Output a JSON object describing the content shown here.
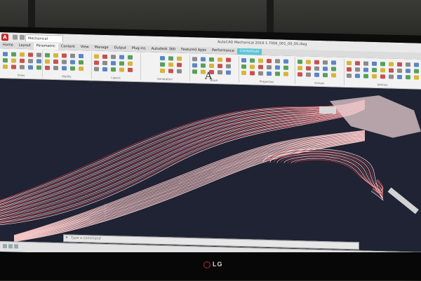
{
  "app": {
    "document_tab": "Mechanical",
    "window_title": "AutoCAD Mechanical 2016    1.7006_001_00_00.dwg",
    "command_placeholder": "Type a command",
    "command_close": "✕",
    "brand_logo": "LG"
  },
  "ribbon_tabs": [
    {
      "label": "Home",
      "active": false
    },
    {
      "label": "Layout",
      "active": false
    },
    {
      "label": "Parametric",
      "active": true
    },
    {
      "label": "Content",
      "active": false
    },
    {
      "label": "View",
      "active": false
    },
    {
      "label": "Manage",
      "active": false
    },
    {
      "label": "Output",
      "active": false
    },
    {
      "label": "Plug-ins",
      "active": false
    },
    {
      "label": "Autodesk 360",
      "active": false
    },
    {
      "label": "Featured Apps",
      "active": false
    },
    {
      "label": "Performance",
      "active": false
    },
    {
      "label": "Contextual",
      "active": false,
      "contextual": true
    }
  ],
  "ribbon_panels": [
    {
      "label": "Draw"
    },
    {
      "label": "Modify"
    },
    {
      "label": "Layers"
    },
    {
      "label": "Annotation"
    },
    {
      "label": "Block"
    },
    {
      "label": "Properties"
    },
    {
      "label": "Groups"
    },
    {
      "label": "Utilities"
    }
  ],
  "annotation_tool": {
    "glyph": "A"
  },
  "icons": {
    "app_menu": "autocad-a-icon",
    "cmd_close": "close-icon"
  },
  "colors": {
    "canvas_bg": "#1f2333",
    "contour_white": "#e8e4ea",
    "contour_red": "#d8343c",
    "contour_pink": "#f3b7b8",
    "context_tab": "#5cc4d6"
  }
}
